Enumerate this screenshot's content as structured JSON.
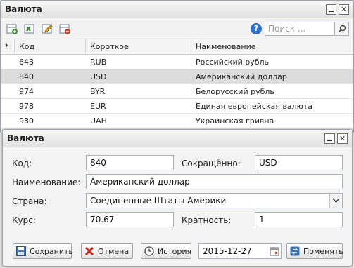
{
  "list_window": {
    "title": "Валюта",
    "search_placeholder": "Поиск ...",
    "columns": [
      "*",
      "Код",
      "Короткое",
      "Наименование"
    ],
    "rows": [
      {
        "code": "643",
        "short": "RUB",
        "name": "Российский рубль"
      },
      {
        "code": "840",
        "short": "USD",
        "name": "Американский доллар"
      },
      {
        "code": "974",
        "short": "BYR",
        "name": "Белорусский рубль"
      },
      {
        "code": "978",
        "short": "EUR",
        "name": "Единая европейская валюта"
      },
      {
        "code": "980",
        "short": "UAH",
        "name": "Украинская гривна"
      }
    ],
    "selected_row": 1
  },
  "form_window": {
    "title": "Валюта",
    "code_label": "Код:",
    "code_value": "840",
    "short_label": "Сокращённо:",
    "short_value": "USD",
    "name_label": "Наименование:",
    "name_value": "Американский доллар",
    "country_label": "Страна:",
    "country_value": "Соединенные Штаты Америки",
    "rate_label": "Курс:",
    "rate_value": "70.67",
    "multiplicity_label": "Кратность:",
    "multiplicity_value": "1",
    "buttons": {
      "save": "Сохранить",
      "cancel": "Отмена",
      "history": "История",
      "date": "2015-12-27",
      "change": "Поменять"
    }
  },
  "colors": {
    "selected_row": "#dcdcdc",
    "accent": "#2f6fc7"
  }
}
